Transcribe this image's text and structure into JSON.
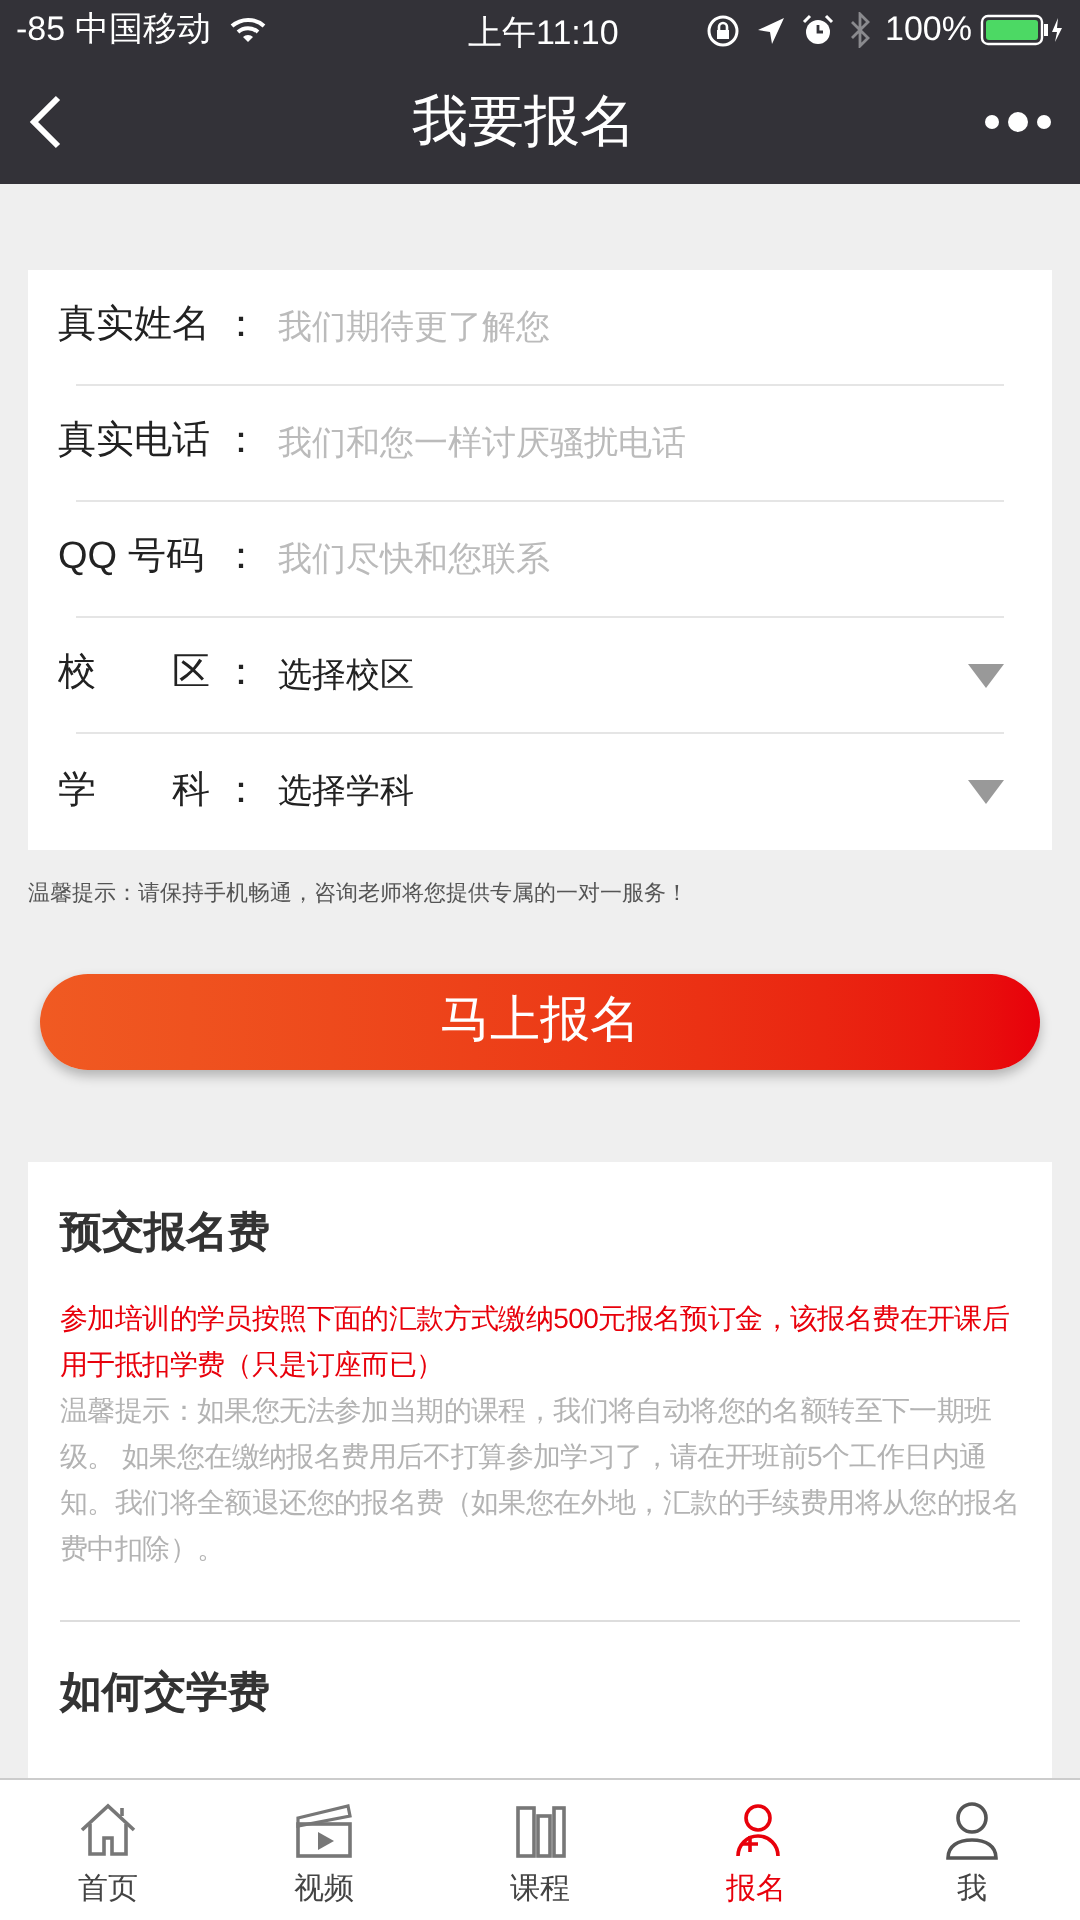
{
  "status_bar": {
    "carrier": "-85 中国移动",
    "time": "上午11:10",
    "battery": "100%"
  },
  "nav": {
    "title": "我要报名"
  },
  "form": {
    "fields": [
      {
        "kind": "text",
        "label": "真实姓名",
        "separator": "：",
        "placeholder": "我们期待更了解您"
      },
      {
        "kind": "text",
        "label": "真实电话",
        "separator": "：",
        "placeholder": "我们和您一样讨厌骚扰电话"
      },
      {
        "kind": "text",
        "label": "QQ 号码",
        "separator": "：",
        "placeholder": "我们尽快和您联系"
      },
      {
        "kind": "select",
        "label": "校　　区",
        "separator": "：",
        "value": "选择校区"
      },
      {
        "kind": "select",
        "label": "学　　科",
        "separator": "：",
        "value": "选择学科"
      }
    ],
    "hint": "温馨提示：请保持手机畅通，咨询老师将您提供专属的一对一服务！",
    "submit": "马上报名"
  },
  "info": {
    "sections": [
      {
        "title": "预交报名费",
        "paragraphs": [
          {
            "kind": "highlight",
            "text": "参加培训的学员按照下面的汇款方式缴纳500元报名预订金，该报名费在开课后用于抵扣学费（只是订座而已）"
          },
          {
            "kind": "note",
            "text": "温馨提示：如果您无法参加当期的课程，我们将自动将您的名额转至下一期班级。 如果您在缴纳报名费用后不打算参加学习了，请在开班前5个工作日内通知。我们将全额退还您的报名费（如果您在外地，汇款的手续费用将从您的报名费中扣除）。"
          }
        ]
      },
      {
        "title": "如何交学费"
      }
    ]
  },
  "tab_bar": {
    "items": [
      {
        "label": "首页",
        "selected": false
      },
      {
        "label": "视频",
        "selected": false
      },
      {
        "label": "课程",
        "selected": false
      },
      {
        "label": "报名",
        "selected": true
      },
      {
        "label": "我",
        "selected": false
      }
    ]
  }
}
